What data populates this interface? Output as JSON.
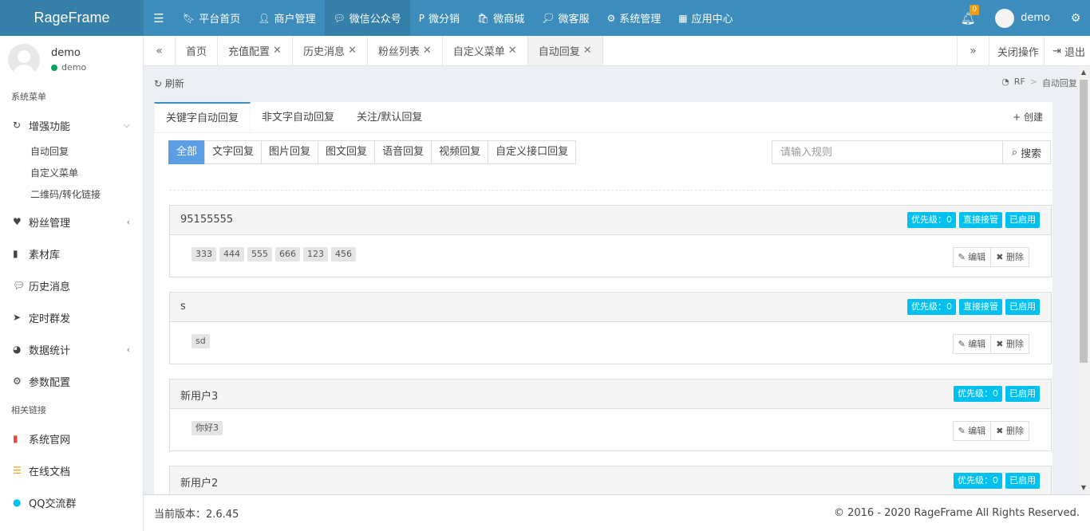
{
  "topbar": {
    "brand": "RageFrame",
    "nav": [
      {
        "label": "平台首页",
        "icon": "bookmark-icon"
      },
      {
        "label": "商户管理",
        "icon": "user-plus-icon"
      },
      {
        "label": "微信公众号",
        "icon": "wechat-icon"
      },
      {
        "label": "微分销",
        "icon": "paypal-icon"
      },
      {
        "label": "微商城",
        "icon": "shopping-bag-icon"
      },
      {
        "label": "微客服",
        "icon": "comments-icon"
      },
      {
        "label": "系统管理",
        "icon": "cogs-icon"
      },
      {
        "label": "应用中心",
        "icon": "grid-icon"
      }
    ],
    "active_nav": "微信公众号",
    "notification_count": "0",
    "username": "demo"
  },
  "sidebar": {
    "user": {
      "name": "demo",
      "status": "demo"
    },
    "section_system": "系统菜单",
    "enhance": {
      "label": "增强功能",
      "subs": [
        "自动回复",
        "自定义菜单",
        "二维码/转化链接"
      ]
    },
    "items": [
      "粉丝管理",
      "素材库",
      "历史消息",
      "定时群发",
      "数据统计",
      "参数配置"
    ],
    "section_links": "相关链接",
    "links": [
      "系统官网",
      "在线文档",
      "QQ交流群"
    ]
  },
  "tabs": {
    "items": [
      {
        "label": "首页",
        "closable": false
      },
      {
        "label": "充值配置",
        "closable": true
      },
      {
        "label": "历史消息",
        "closable": true
      },
      {
        "label": "粉丝列表",
        "closable": true
      },
      {
        "label": "自定义菜单",
        "closable": true
      },
      {
        "label": "自动回复",
        "closable": true
      }
    ],
    "close_ops": "关闭操作",
    "logout": "退出"
  },
  "content": {
    "refresh": "刷新",
    "breadcrumb": [
      "RF",
      "自动回复"
    ],
    "box_tabs": [
      "关键字自动回复",
      "非文字自动回复",
      "关注/默认回复"
    ],
    "create": "创建",
    "filters": [
      "全部",
      "文字回复",
      "图片回复",
      "图文回复",
      "语音回复",
      "视频回复",
      "自定义接口回复"
    ],
    "search_placeholder": "请输入规则",
    "search_button": "搜索",
    "rules": [
      {
        "title": "95155555",
        "labels": [
          "优先级：0",
          "直接接管",
          "已启用"
        ],
        "keywords": [
          "333",
          "444",
          "555",
          "666",
          "123",
          "456"
        ]
      },
      {
        "title": "s",
        "labels": [
          "优先级：0",
          "直接接管",
          "已启用"
        ],
        "keywords": [
          "sd"
        ]
      },
      {
        "title": "新用户3",
        "labels": [
          "优先级：0",
          "已启用"
        ],
        "keywords": [
          "你好3"
        ]
      },
      {
        "title": "新用户2",
        "labels": [
          "优先级：0",
          "已启用"
        ],
        "keywords": []
      }
    ],
    "edit": "编辑",
    "delete": "删除"
  },
  "footer": {
    "version": "当前版本：2.6.45",
    "copyright": "© 2016 - 2020 RageFrame All Rights Reserved."
  },
  "colors": {
    "primary": "#3c8dbc",
    "primary_dark": "#367fa9",
    "label": "#00c0ef",
    "filter_active": "#5b9ee3"
  }
}
